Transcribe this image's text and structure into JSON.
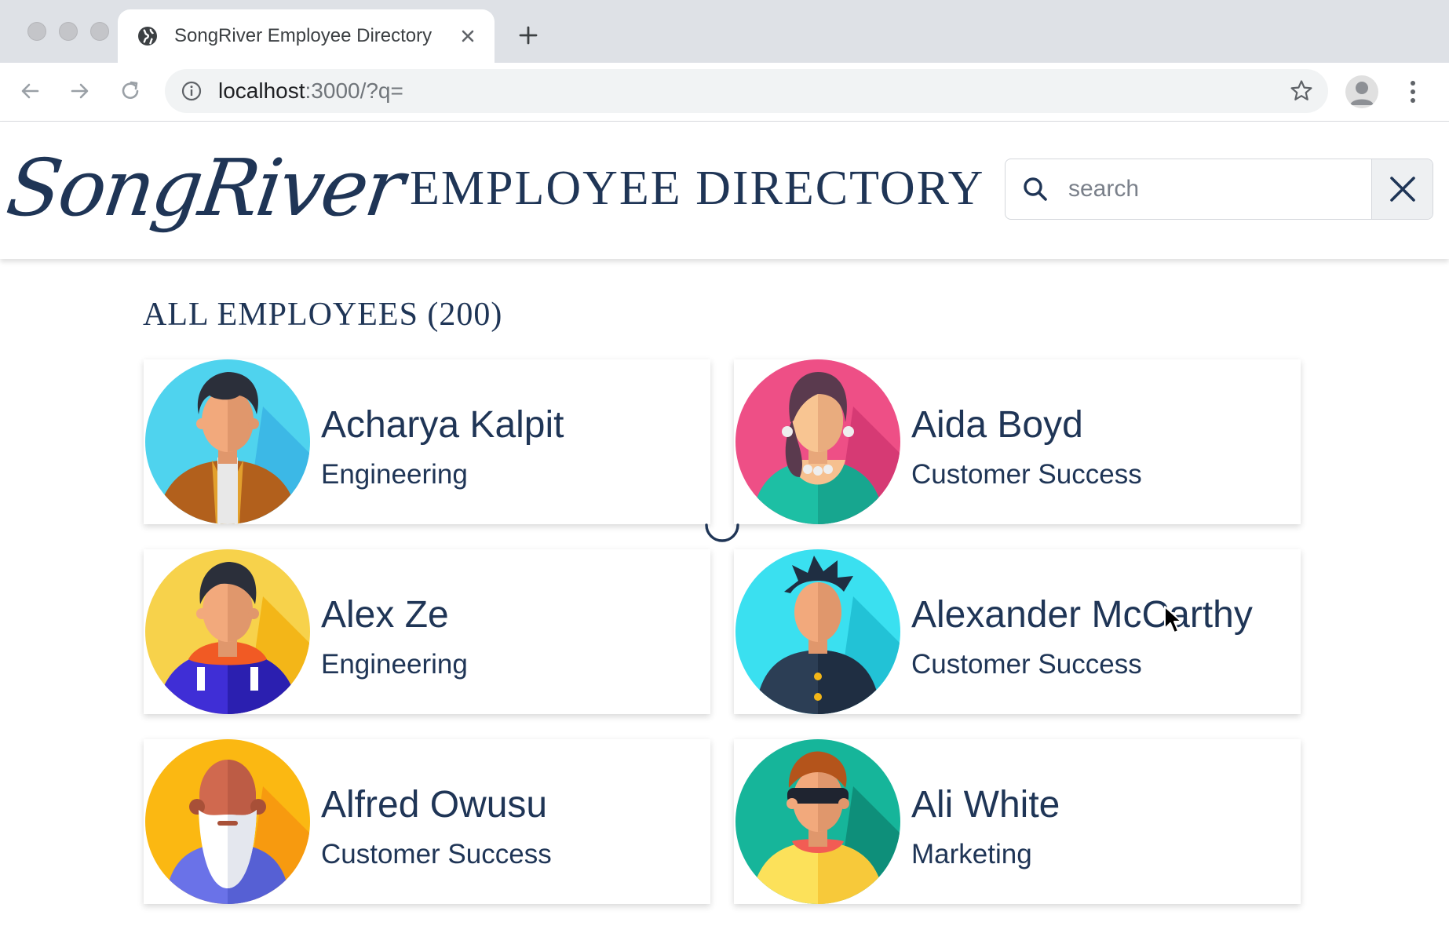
{
  "browser": {
    "tab_title": "SongRiver Employee Directory",
    "url_host": "localhost",
    "url_rest": ":3000/?q="
  },
  "header": {
    "logo_text": "SongRiver",
    "title": "EMPLOYEE DIRECTORY",
    "search_placeholder": "search"
  },
  "main": {
    "section_title": "ALL EMPLOYEES (200)",
    "employees": [
      {
        "name": "Acharya Kalpit",
        "department": "Engineering"
      },
      {
        "name": "Aida Boyd",
        "department": "Customer Success"
      },
      {
        "name": "Alex Ze",
        "department": "Engineering"
      },
      {
        "name": "Alexander McCarthy",
        "department": "Customer Success"
      },
      {
        "name": "Alfred Owusu",
        "department": "Customer Success"
      },
      {
        "name": "Ali White",
        "department": "Marketing"
      }
    ]
  },
  "colors": {
    "brand": "#1f3556",
    "avatar_backgrounds": [
      "#4fd3ee",
      "#ee4f86",
      "#f7c531",
      "#3ae0f0",
      "#fbb812",
      "#16b59a"
    ]
  },
  "icons": [
    "globe-icon",
    "close-icon",
    "plus-icon",
    "back-arrow-icon",
    "forward-arrow-icon",
    "reload-icon",
    "info-icon",
    "star-icon",
    "profile-icon",
    "kebab-menu-icon",
    "search-icon",
    "clear-icon",
    "loading-spinner",
    "mouse-cursor"
  ]
}
